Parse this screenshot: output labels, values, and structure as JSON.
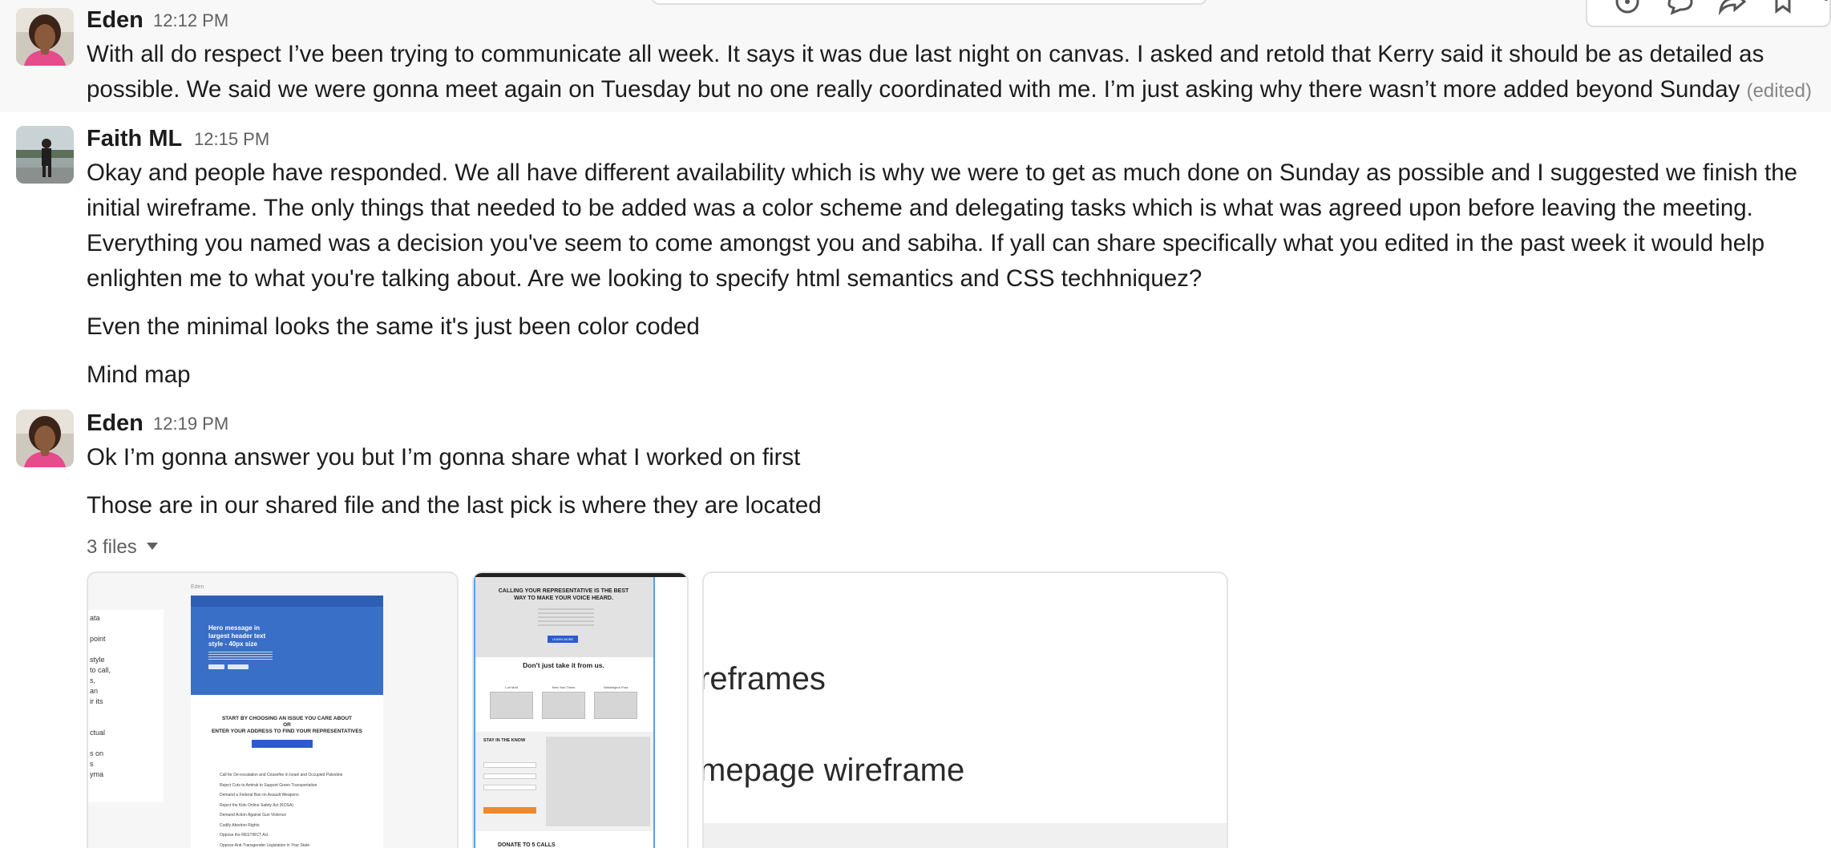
{
  "messages": [
    {
      "author": "Eden",
      "time": "12:12 PM",
      "lines": [
        "With all do respect I’ve been trying to communicate all week. It says it was due last night on canvas. I asked and retold that Kerry said it should be as detailed as",
        "possible. We said we were gonna meet again on Tuesday but no one really coordinated with me. I’m just asking why there wasn’t more added beyond Sunday"
      ],
      "edited": "(edited)"
    },
    {
      "author": "Faith ML",
      "time": "12:15 PM",
      "lines": [
        "Okay and people have responded. We all have different availability which is why we were to get as much done on Sunday as possible and I suggested we finish the",
        "initial wireframe. The only things that needed to be added was a color scheme and delegating tasks which is what was agreed upon before leaving the meeting.",
        "Everything you named was a decision you've seem to come amongst you and sabiha. If yall can share specifically what you edited in the past week it would help",
        "enlighten me to what you're talking about. Are we looking to specify html semantics and CSS techhniquez?"
      ],
      "followups": [
        "Even the minimal looks the same it's just been color coded",
        "Mind map"
      ]
    },
    {
      "author": "Eden",
      "time": "12:19 PM",
      "lines": [
        "Ok I’m gonna answer you but I’m gonna share what I worked on first"
      ],
      "followups": [
        "Those are in our shared file and the last pick is where they are located"
      ]
    }
  ],
  "files": {
    "toggle_label": "3 files",
    "thumb1": {
      "sidebar_text": [
        "ata",
        "",
        "point",
        "",
        "style",
        "to call,",
        "s,",
        "an",
        "ir its",
        "",
        "",
        "ctual",
        "",
        "s on",
        "s",
        "yma"
      ],
      "page_label": "Eden",
      "hero_title": [
        "Hero message in",
        "largest header text",
        "style - 40px size"
      ],
      "cta": [
        "START BY CHOOSING AN ISSUE YOU CARE ABOUT",
        "OR",
        "ENTER YOUR ADDRESS TO FIND YOUR REPRESENTATIVES"
      ],
      "issues": [
        "Call for De-escalation and Ceasefire in Israel and Occupied Palestine",
        "Reject Cuts to Amtrak to Support Green Transportation",
        "Demand a Federal Ban on Assault Weapons",
        "Reject the Kids Online Safety Act (KOSA)",
        "Demand Action Against Gun Violence",
        "Codify Abortion Rights",
        "Oppose the RESTRICT Act",
        "Oppose Anti-Transgender Legislation in Your State"
      ]
    },
    "thumb2": {
      "headline": [
        "CALLING YOUR REPRESENTATIVE IS THE BEST",
        "WAY TO MAKE YOUR VOICE HEARD."
      ],
      "button": "LEARN MORE",
      "subhead": "Don't just take it from us.",
      "card_labels": [
        "Lori Mott",
        "New York Times",
        "Washington Post"
      ],
      "stay": "STAY IN THE KNOW",
      "donate": "DONATE TO 5 CALLS"
    },
    "thumb3": {
      "line1": "reframes",
      "line2": "mepage wireframe"
    }
  },
  "colors": {
    "hover_bg": "#f8f8f8",
    "time": "#616061",
    "hero_blue": "#3a6fc7"
  }
}
